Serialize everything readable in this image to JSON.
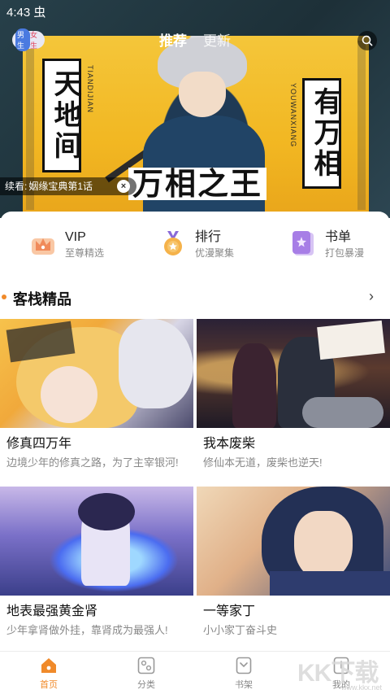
{
  "status_bar": {
    "time": "4:43 虫"
  },
  "header": {
    "gender_toggle": {
      "male": "男生",
      "female": "女生"
    },
    "tabs": [
      {
        "label": "推荐",
        "active": true
      },
      {
        "label": "更新",
        "active": false
      }
    ],
    "search_icon": "search-icon"
  },
  "banner": {
    "title_left": "天地间",
    "subtitle_left": "TIANDIJIAN",
    "title_right": "有万相",
    "subtitle_right": "YOUWANXIANG",
    "logo": "万相之王",
    "continue_label": "续看:",
    "continue_title": "姻缘宝典第1话",
    "close_symbol": "×"
  },
  "quick_menu": [
    {
      "title": "VIP",
      "subtitle": "至尊精选",
      "icon": "crown-icon",
      "color": "#f5a04a"
    },
    {
      "title": "排行",
      "subtitle": "优漫聚集",
      "icon": "medal-icon",
      "color": "#f0a640"
    },
    {
      "title": "书单",
      "subtitle": "打包暴漫",
      "icon": "booklist-icon",
      "color": "#9b6ee0"
    }
  ],
  "section": {
    "title": "客栈精品",
    "more": "›"
  },
  "comics": [
    {
      "name": "修真四万年",
      "desc": "边境少年的修真之路，为了主宰银河!"
    },
    {
      "name": "我本废柴",
      "desc": "修仙本无道，废柴也逆天!"
    },
    {
      "name": "地表最强黄金肾",
      "desc": "少年拿肾做外挂，靠肾成为最强人!"
    },
    {
      "name": "一等家丁",
      "desc": "小小家丁奋斗史"
    }
  ],
  "bottom_nav": [
    {
      "label": "首页",
      "icon": "home-icon",
      "active": true
    },
    {
      "label": "分类",
      "icon": "category-icon",
      "active": false
    },
    {
      "label": "书架",
      "icon": "bookshelf-icon",
      "active": false
    },
    {
      "label": "我的",
      "icon": "profile-icon",
      "active": false
    }
  ],
  "colors": {
    "accent": "#f08a2a"
  },
  "watermark": {
    "text": "KK下载",
    "url": "www.kkx.net"
  }
}
